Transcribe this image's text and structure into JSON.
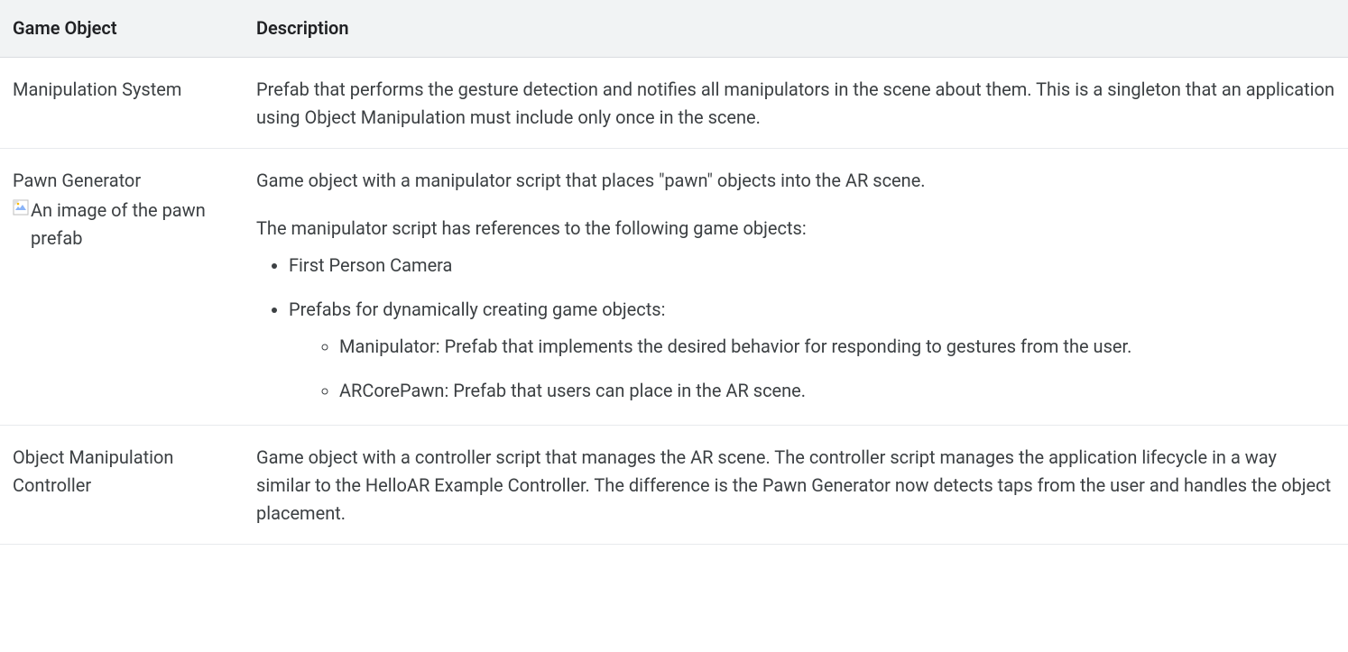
{
  "table": {
    "headers": [
      "Game Object",
      "Description"
    ],
    "rows": [
      {
        "name": "Manipulation System",
        "desc": "Prefab that performs the gesture detection and notifies all manipulators in the scene about them. This is a singleton that an application using Object Manipulation must include only once in the scene."
      },
      {
        "name": "Pawn Generator",
        "alt": "An image of the pawn prefab",
        "desc_intro": "Game object with a manipulator script that places \"pawn\" objects into the AR scene.",
        "desc_sub": "The manipulator script has references to the following game objects:",
        "items": [
          "First Person Camera",
          "Prefabs for dynamically creating game objects:"
        ],
        "subitems": [
          "Manipulator: Prefab that implements the desired behavior for responding to gestures from the user.",
          "ARCorePawn: Prefab that users can place in the AR scene."
        ]
      },
      {
        "name": "Object Manipulation Controller",
        "desc": "Game object with a controller script that manages the AR scene. The controller script manages the application lifecycle in a way similar to the HelloAR Example Controller. The difference is the Pawn Generator now detects taps from the user and handles the object placement."
      }
    ]
  }
}
